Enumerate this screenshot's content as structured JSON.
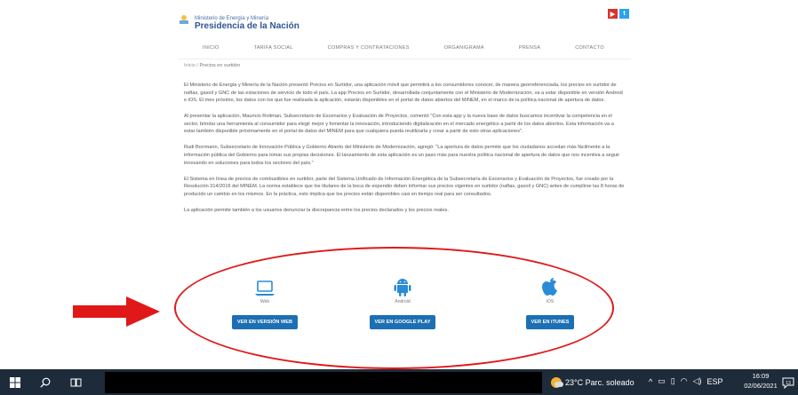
{
  "header": {
    "ministry": "Ministerio de Energía y Minería",
    "presidency": "Presidencia de la Nación",
    "social": [
      {
        "name": "youtube",
        "glyph": "▶",
        "color": "#d9332b"
      },
      {
        "name": "twitter",
        "glyph": "t",
        "color": "#2aa3ef"
      }
    ]
  },
  "nav": {
    "items": [
      "INICIO",
      "TARIFA SOCIAL",
      "COMPRAS Y CONTRATACIONES",
      "ORGANIGRAMA",
      "PRENSA",
      "CONTACTO"
    ]
  },
  "breadcrumb": {
    "home": "Inicio",
    "separator": "/",
    "current": "Precios en surtidor"
  },
  "article": {
    "paragraphs": [
      "El Ministerio de Energía y Minería de la Nación presentó Precios en Surtidor, una aplicación móvil que permitirá a los consumidores conocer, de manera georreferenciada, los precios en surtidor de naftas, gasoil y GNC de las estaciones de servicio de todo el país. La app Precios en Surtidor, desarrollada conjuntamente con el Ministerio de Modernización, va a estar disponible en versión Android e iOS. El mes próximo, los datos con los que fue realizada la aplicación, estarán disponibles en el portal de datos abiertos del MINEM, en el marco de la política nacional de apertura de datos.",
      "Al presentar la aplicación, Mauricio Roitman, Subsecretario de Escenarios y Evaluación de Proyectos, comentó \"Con esta app y la nueva base de datos buscamos incentivar la competencia en el sector, brindar una herramienta al consumidor para elegir mejor y fomentar la innovación, introduciendo digitalización en el mercado energético a partir de los datos abiertos. Esta información va a estar también disponible próximamente en el portal de datos del MINEM para que cualquiera pueda reutilizarla y crear a partir de esto otras aplicaciones\".",
      "Rudi Borrmann, Subsecretario de Innovación Pública y Gobierno Abierto del Ministerio de Modernización, agregó: \"La apertura de datos permite que los ciudadanos accedan más fácilmente a la información pública del Gobierno para tomar sus propias decisiones. El lanzamiento de esta aplicación es un paso más para nuestra política nacional de apertura de datos que nos incentiva a seguir innovando en soluciones para todos los sectores del país.\"",
      "El Sistema en línea de precios de combustibles en surtidor, parte del Sistema Unificado de Información Energética de la Subsecretaría de Escenarios y Evaluación de Proyectos, fue creado por la Resolución 314/2016 del MINEM. La norma establece que los titulares de la boca de expendio deben informar sus precios vigentes en surtidor (naftas, gasoil y GNC) antes de cumplirse las 8 horas de producido un cambio en los mismos. En la práctica, esto implica que los precios están disponibles casi en tiempo real para ser consultados.",
      "La aplicación permite también a los usuarios denunciar la discrepancia entre los precios declarados y los precios reales."
    ]
  },
  "apps": [
    {
      "name": "Web",
      "icon": "laptop-icon",
      "button": "VER EN VERSIÓN WEB"
    },
    {
      "name": "Android",
      "icon": "android-icon",
      "button": "VER EN GOOGLE PLAY"
    },
    {
      "name": "iOS",
      "icon": "apple-icon",
      "button": "VER EN iTUNES"
    }
  ],
  "colors": {
    "accent": "#1c6fb3",
    "annotation": "#e01818",
    "taskbar": "#1e2b3a"
  },
  "taskbar": {
    "weather": "23°C  Parc. soleado",
    "language": "ESP",
    "time": "16:09",
    "date": "02/06/2021",
    "notifications": "13"
  }
}
